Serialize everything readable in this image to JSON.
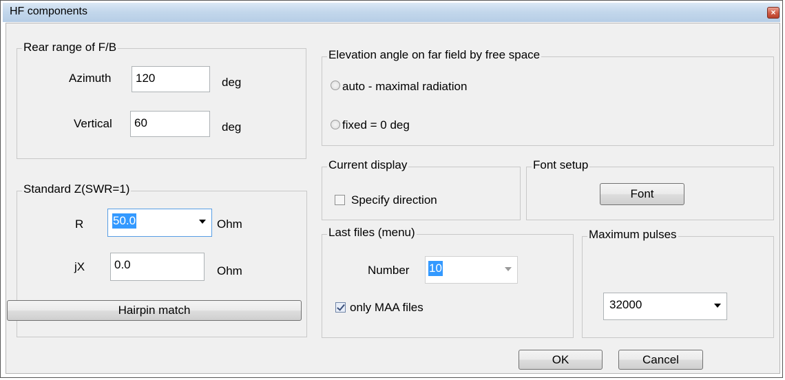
{
  "window": {
    "title": "HF components",
    "close_glyph": "×"
  },
  "rear_range": {
    "legend": "Rear range of F/B",
    "azimuth_label": "Azimuth",
    "azimuth_value": "120",
    "azimuth_unit": "deg",
    "vertical_label": "Vertical",
    "vertical_value": "60",
    "vertical_unit": "deg"
  },
  "elevation": {
    "legend": "Elevation angle on far field by free space",
    "option_auto": "auto - maximal radiation",
    "option_fixed": "fixed = 0 deg",
    "selected": "none"
  },
  "standard_z": {
    "legend": "Standard Z(SWR=1)",
    "r_label": "R",
    "r_value": "50.0",
    "r_unit": "Ohm",
    "jx_label": "jX",
    "jx_value": "0.0",
    "jx_unit": "Ohm",
    "hairpin_button": "Hairpin match"
  },
  "current_display": {
    "legend": "Current display",
    "specify_direction": "Specify direction",
    "specify_direction_checked": false
  },
  "font_setup": {
    "legend": "Font setup",
    "font_button": "Font"
  },
  "last_files": {
    "legend": "Last files (menu)",
    "number_label": "Number",
    "number_value": "10",
    "only_maa": "only MAA files",
    "only_maa_checked": true
  },
  "max_pulses": {
    "legend": "Maximum pulses",
    "value": "32000"
  },
  "footer": {
    "ok_button": "OK",
    "cancel_button": "Cancel"
  }
}
